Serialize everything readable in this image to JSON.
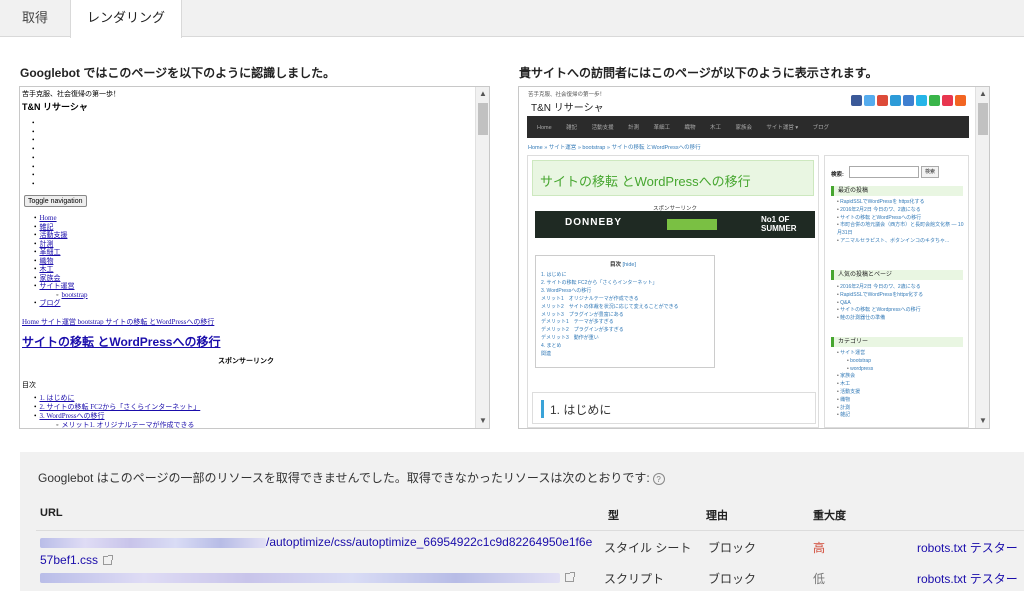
{
  "tabs": [
    {
      "label": "取得"
    },
    {
      "label": "レンダリング"
    }
  ],
  "headings": {
    "googlebot": "Googlebot ではこのページを以下のように認識しました。",
    "visitor": "貴サイトへの訪問者にはこのページが以下のように表示されます。"
  },
  "googlebot_view": {
    "tagline": "苦手克服、社会復帰の第一歩！",
    "site_title": "T&N リサーシャ",
    "toggle_label": "Toggle navigation",
    "nav_items": [
      "Home",
      "雑記",
      "活動支援",
      "計測",
      "革細工",
      "織物",
      "木工",
      "家族会",
      "サイト運営"
    ],
    "nav_sub": "bootstrap",
    "nav_blog": "ブログ",
    "breadcrumb": "Home サイト運営 bootstrap サイトの移転 とWordPressへの移行",
    "page_title": "サイトの移転 とWordPressへの移行",
    "sponsor": "スポンサーリンク",
    "toc_title": "目次",
    "toc_items": [
      "1. はじめに",
      "2. サイトの移転 FC2から「さくらインターネット」",
      "3. WordPressへの移行"
    ],
    "toc_sub": "メリット1. オリジナルテーマが作成できる"
  },
  "visitor_view": {
    "tagline": "苦手克服、社会復帰の第一歩！",
    "site_title": "T&N リサーシャ",
    "nav_items": [
      "Home",
      "雑記",
      "活動支援",
      "計測",
      "革細工",
      "織物",
      "木工",
      "家族会",
      "サイト運営 ▾",
      "ブログ"
    ],
    "breadcrumb": "Home » サイト運営 » bootstrap » サイトの移転 とWordPressへの移行",
    "page_title": "サイトの移転 とWordPressへの移行",
    "sponsor": "スポンサーリンク",
    "ad_brand": "DONNEBY",
    "ad_right": "No1 OF SUMMER",
    "toc_title": "目次",
    "toc_hide": "[hide]",
    "toc_items": [
      "1. はじめに",
      "2. サイトの移転 FC2から「さくらインターネット」",
      "3. WordPressへの移行",
      "  メリット1　オリジナルテーマが作成できる",
      "  メリット2　サイトの体裁を状況に応じて変えることができる",
      "  メリット3　プラグインが豊富にある",
      "  デメリット1　テーマが多すぎる",
      "  デメリット2　プラグインが多すぎる",
      "  デメリット3　動作が重い",
      "4. まとめ",
      "関連"
    ],
    "section_heading": "1. はじめに",
    "search_label": "検索:",
    "search_button": "検索",
    "side_recent_title": "最近の投稿",
    "side_recent": [
      "RapidSSLでWordPressを https化する",
      "2016年2月2日 今日のワ、2歳になる",
      "サイトの移転 とWordPressへの移行",
      "市町合併の地元議会（西方市）と長町会館文化祭 — 10月31日",
      "アニマルセラピスト、ボタンインコのキタちゃ..."
    ],
    "side_popular_title": "人気の投稿とページ",
    "side_popular": [
      "2016年2月2日 今日のワ、2歳になる",
      "RapidSSLでWordPressをhttps化する",
      "Q&A",
      "サイトの移転 とWordpressへの移行",
      "鮭の計測器仕の準備"
    ],
    "side_cat_title": "カテゴリー",
    "side_cats": [
      "サイト運営",
      "bootstrap",
      "wordpress",
      "家族会",
      "木工",
      "活動支援",
      "織物",
      "計測",
      "雑記"
    ]
  },
  "resources": {
    "message": "Googlebot はこのページの一部のリソースを取得できませんでした。取得できなかったリソースは次のとおりです:",
    "help_icon": "?",
    "columns": {
      "url": "URL",
      "type": "型",
      "reason": "理由",
      "severity": "重大度"
    },
    "rows": [
      {
        "url_visible": "/autoptimize/css/autoptimize_66954922c1c9d82264950e1f6e",
        "url_wrap": "57bef1.css",
        "type": "スタイル シート",
        "reason": "ブロック",
        "severity": "高",
        "tester": "robots.txt テスター"
      },
      {
        "url_visible": "",
        "type": "スクリプト",
        "reason": "ブロック",
        "severity": "低",
        "tester": "robots.txt テスター"
      }
    ]
  },
  "colors": {
    "accent_green": "#46a62f",
    "link_blue": "#1a0dab",
    "severity_high": "#d14836"
  }
}
